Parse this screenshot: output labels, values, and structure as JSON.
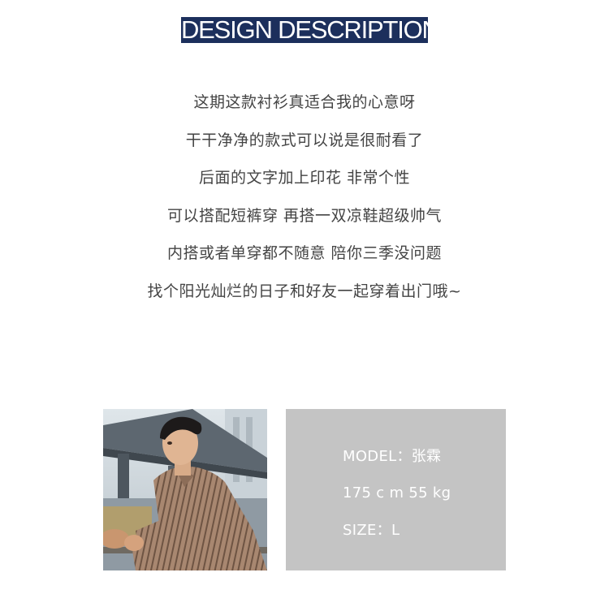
{
  "header": {
    "title": "DESIGN DESCRIPTION"
  },
  "description": {
    "lines": [
      "这期这款衬衫真适合我的心意呀",
      "干干净净的款式可以说是很耐看了",
      "后面的文字加上印花 非常个性",
      "可以搭配短裤穿 再搭一双凉鞋超级帅气",
      "内搭或者单穿都不随意 陪你三季没问题",
      "找个阳光灿烂的日子和好友一起穿着出门哦~"
    ]
  },
  "model_info": {
    "model": "MODEL：张霖",
    "measurements": "175 c m  55 kg",
    "size": "SIZE：L"
  },
  "colors": {
    "title_background": "#1c2f5c",
    "info_background": "#c4c4c4",
    "text": "#444444"
  }
}
